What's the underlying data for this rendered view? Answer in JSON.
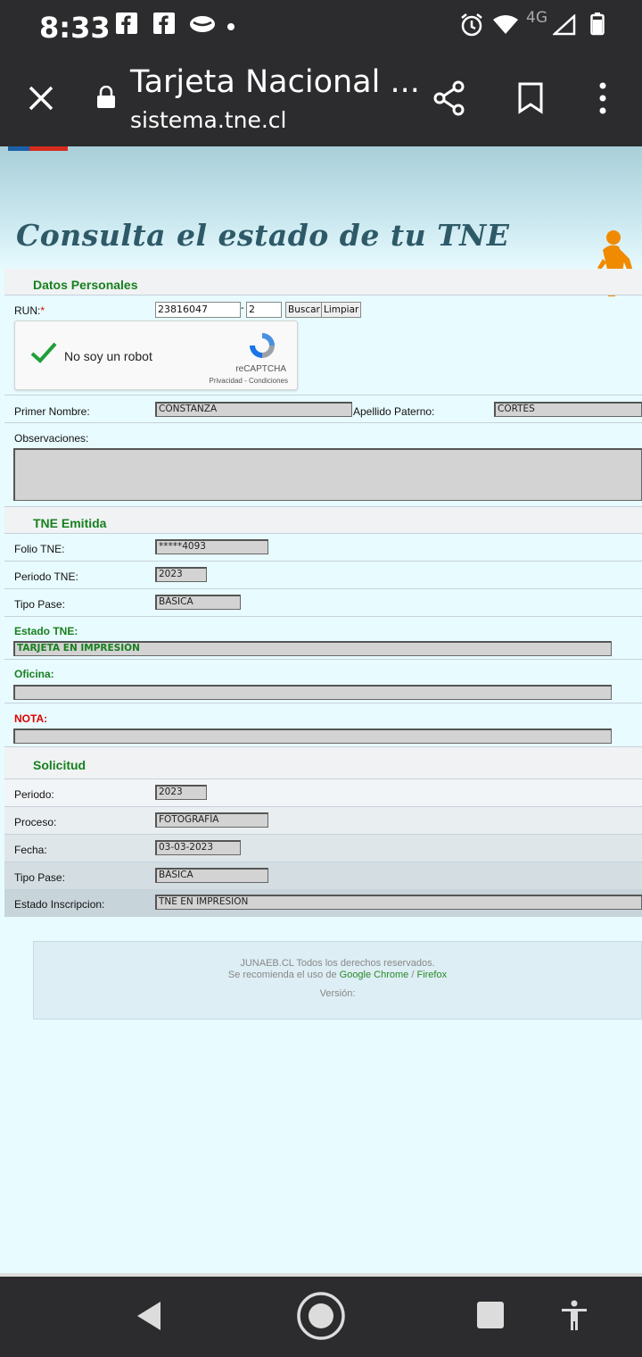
{
  "status_bar": {
    "time": "8:33",
    "network": "4G"
  },
  "browser": {
    "title": "Tarjeta Nacional ...",
    "url": "sistema.tne.cl"
  },
  "banner": {
    "title": "Consulta el estado de tu TNE"
  },
  "datos_personales": {
    "section_title": "Datos Personales",
    "run_label": "RUN:",
    "run_required": "*",
    "run_value": "23816047",
    "run_separator": "-",
    "dv_value": "2",
    "buscar_label": "Buscar",
    "limpiar_label": "Limpiar",
    "captcha_label": "No soy un robot",
    "captcha_brand": "reCAPTCHA",
    "captcha_terms": "Privacidad - Condiciones",
    "primer_nombre_label": "Primer Nombre:",
    "primer_nombre_value": "CONSTANZA",
    "apellido_paterno_label": "Apellido Paterno:",
    "apellido_paterno_value": "CORTÉS",
    "observaciones_label": "Observaciones:"
  },
  "tne_emitida": {
    "section_title": "TNE Emitida",
    "folio_label": "Folio TNE:",
    "folio_value": "*****4093",
    "periodo_label": "Periodo TNE:",
    "periodo_value": "2023",
    "tipo_pase_label": "Tipo Pase:",
    "tipo_pase_value": "BÁSICA",
    "estado_label": "Estado TNE:",
    "estado_value": "TARJETA EN IMPRESIÓN",
    "oficina_label": "Oficina:",
    "nota_label": "NOTA:"
  },
  "solicitud": {
    "section_title": "Solicitud",
    "periodo_label": "Periodo:",
    "periodo_value": "2023",
    "proceso_label": "Proceso:",
    "proceso_value": "FOTOGRAFÍA",
    "fecha_label": "Fecha:",
    "fecha_value": "03-03-2023",
    "tipo_pase_label": "Tipo Pase:",
    "tipo_pase_value": "BÁSICA",
    "estado_inscripcion_label": "Estado Inscripcion:",
    "estado_inscripcion_value": "TNE EN IMPRESION"
  },
  "footer": {
    "copyright": "JUNAEB.CL Todos los derechos reservados.",
    "recommend_prefix": "Se recomienda el uso de",
    "chrome_link": "Google Chrome",
    "link_separator": "/",
    "firefox_link": "Firefox",
    "version_label": "Versión:"
  },
  "colors": {
    "accent_green": "#18801e",
    "required_red": "#e00000",
    "chrome_bar": "#2c2c2e"
  }
}
